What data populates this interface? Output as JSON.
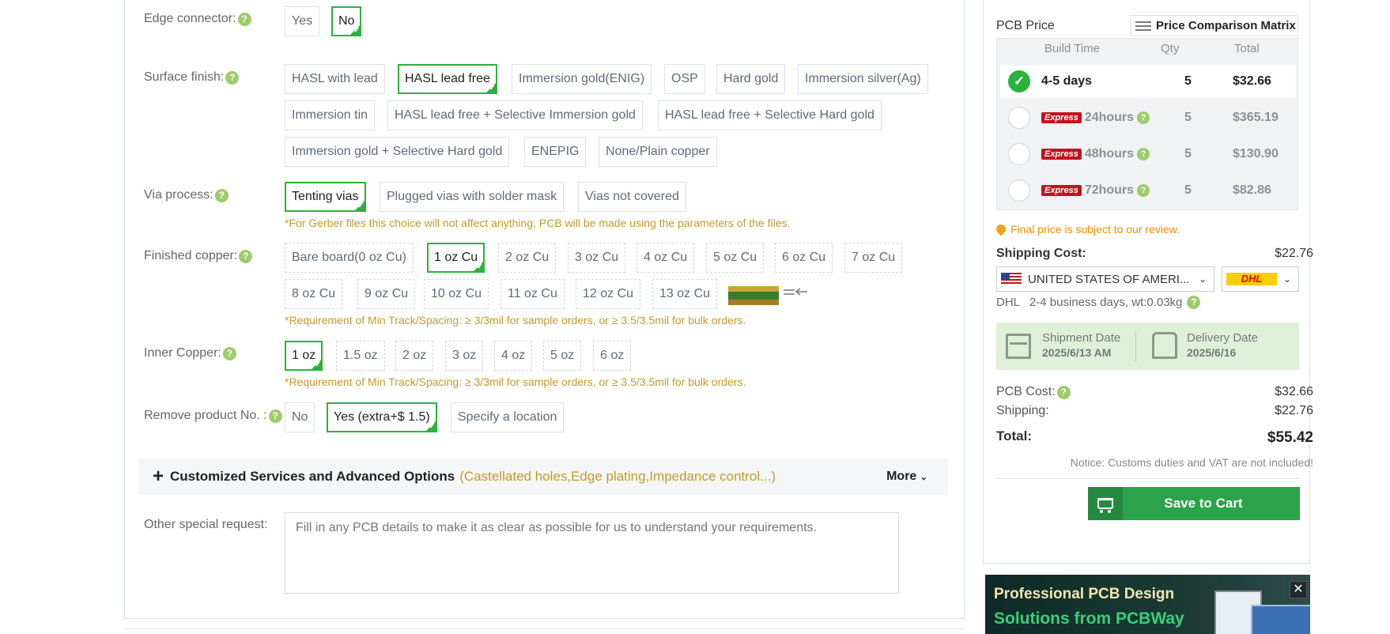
{
  "form": {
    "edge_connector": {
      "label": "Edge connector:",
      "options": [
        "Yes",
        "No"
      ]
    },
    "surface_finish": {
      "label": "Surface finish:",
      "options": [
        "HASL with lead",
        "HASL lead free",
        "Immersion gold(ENIG)",
        "OSP",
        "Hard gold",
        "Immersion silver(Ag)",
        "Immersion tin",
        "HASL lead free + Selective Immersion gold",
        "HASL lead free + Selective Hard gold",
        "Immersion gold + Selective Hard gold",
        "ENEPIG",
        "None/Plain copper"
      ]
    },
    "via_process": {
      "label": "Via process:",
      "options": [
        "Tenting vias",
        "Plugged vias with solder mask",
        "Vias not covered"
      ],
      "note": "*For Gerber files this choice will not affect anything, PCB will be made using the parameters of the files."
    },
    "finished_copper": {
      "label": "Finished copper:",
      "options": [
        "Bare board(0 oz Cu)",
        "1 oz Cu",
        "2 oz Cu",
        "3 oz Cu",
        "4 oz Cu",
        "5 oz Cu",
        "6 oz Cu",
        "7 oz Cu",
        "8 oz Cu",
        "9 oz Cu",
        "10 oz Cu",
        "11 oz Cu",
        "12 oz Cu",
        "13 oz Cu"
      ],
      "note": "*Requirement of Min Track/Spacing: ≥ 3/3mil for sample orders, or ≥ 3.5/3.5mil for bulk orders."
    },
    "inner_copper": {
      "label": "Inner Copper:",
      "options": [
        "1 oz",
        "1.5 oz",
        "2 oz",
        "3 oz",
        "4 oz",
        "5 oz",
        "6 oz"
      ],
      "note": "*Requirement of Min Track/Spacing: ≥ 3/3mil for sample orders, or ≥ 3.5/3.5mil for bulk orders."
    },
    "remove_product_no": {
      "label": "Remove product No. :",
      "options": [
        "No",
        "Yes (extra+$ 1.5)",
        "Specify a location"
      ]
    },
    "advanced": {
      "plus": "+",
      "title": "Customized Services and Advanced Options",
      "subtitle": "(Castellated holes,Edge plating,Impedance control...)",
      "more": "More"
    },
    "special_request": {
      "label": "Other special request:",
      "placeholder": "Fill in any PCB details to make it as clear as possible for us to understand your requirements."
    },
    "help_glyph": "?"
  },
  "price": {
    "title": "PCB Price",
    "matrix_button": "Price Comparison Matrix",
    "headers": {
      "build_time": "Build Time",
      "qty": "Qty",
      "total": "Total"
    },
    "rows": [
      {
        "express": "",
        "time": "4-5 days",
        "qty": "5",
        "total": "$32.66"
      },
      {
        "express": "Express",
        "time": "24hours",
        "qty": "5",
        "total": "$365.19"
      },
      {
        "express": "Express",
        "time": "48hours",
        "qty": "5",
        "total": "$130.90"
      },
      {
        "express": "Express",
        "time": "72hours",
        "qty": "5",
        "total": "$82.86"
      }
    ],
    "final_note": "Final price is subject to our review.",
    "shipping_cost_label": "Shipping Cost:",
    "shipping_cost": "$22.76",
    "country": "UNITED STATES OF AMERI...",
    "carrier_logo": "DHL",
    "ship_info": "DHL   2-4 business days, wt:0.03kg",
    "shipment_date_label": "Shipment Date",
    "shipment_date": "2025/6/13 AM",
    "delivery_date_label": "Delivery Date",
    "delivery_date": "2025/6/16",
    "pcb_cost_label": "PCB Cost:",
    "pcb_cost": "$32.66",
    "shipping_label": "Shipping:",
    "shipping": "$22.76",
    "total_label": "Total:",
    "total": "$55.42",
    "customs_notice": "Notice: Customs duties and VAT are not included!",
    "save_button": "Save to Cart"
  },
  "banner": {
    "line1": "Professional PCB Design",
    "line2": "Solutions from PCBWay",
    "close": "✕"
  },
  "colors": {
    "selected_border": "#2ab33a",
    "note_text": "#c49a2a",
    "cart_green": "#2aa34a",
    "express_red": "#c0141d",
    "dates_bg": "#dff0d8"
  }
}
